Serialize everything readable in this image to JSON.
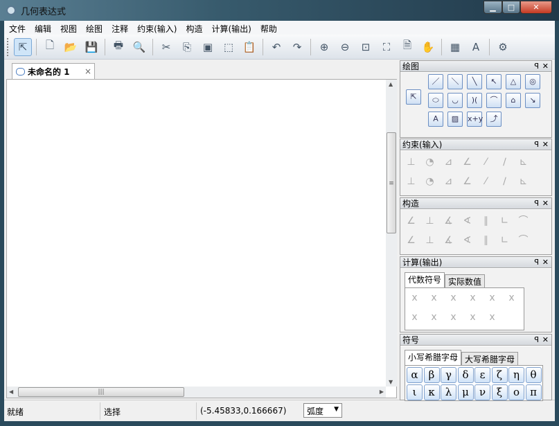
{
  "window": {
    "title": "几何表达式",
    "minimize": "▁",
    "maximize": "□",
    "close": "✕"
  },
  "menu": [
    "文件",
    "编辑",
    "视图",
    "绘图",
    "注释",
    "约束(输入)",
    "构造",
    "计算(输出)",
    "帮助"
  ],
  "toolbar": [
    {
      "icon": "select-arrow-icon",
      "glyph": "⇱",
      "selected": true
    },
    {
      "sep": true
    },
    {
      "icon": "new-file-icon",
      "glyph": "🗋"
    },
    {
      "icon": "open-folder-icon",
      "glyph": "📂"
    },
    {
      "icon": "save-icon",
      "glyph": "💾"
    },
    {
      "sep": true
    },
    {
      "icon": "print-icon",
      "glyph": "🖶"
    },
    {
      "icon": "print-preview-icon",
      "glyph": "🔍"
    },
    {
      "sep": true
    },
    {
      "icon": "cut-icon",
      "glyph": "✂"
    },
    {
      "icon": "copy-icon",
      "glyph": "⎘"
    },
    {
      "icon": "copy-window-icon",
      "glyph": "▣"
    },
    {
      "icon": "copy-selection-icon",
      "glyph": "⬚"
    },
    {
      "icon": "paste-icon",
      "glyph": "📋"
    },
    {
      "sep": true
    },
    {
      "icon": "undo-icon",
      "glyph": "↶"
    },
    {
      "icon": "redo-icon",
      "glyph": "↷"
    },
    {
      "sep": true
    },
    {
      "icon": "zoom-in-icon",
      "glyph": "⊕"
    },
    {
      "icon": "zoom-out-icon",
      "glyph": "⊖"
    },
    {
      "icon": "zoom-rect-icon",
      "glyph": "⊡"
    },
    {
      "icon": "zoom-fit-icon",
      "glyph": "⛶"
    },
    {
      "icon": "zoom-page-icon",
      "glyph": "🗎"
    },
    {
      "icon": "pan-hand-icon",
      "glyph": "✋"
    },
    {
      "sep": true
    },
    {
      "icon": "grid-icon",
      "glyph": "▦"
    },
    {
      "icon": "font-icon",
      "glyph": "A"
    },
    {
      "sep": true
    },
    {
      "icon": "settings-gears-icon",
      "glyph": "⚙"
    }
  ],
  "document_tab": {
    "label": "未命名的 1",
    "close": "×"
  },
  "status": {
    "ready": "就绪",
    "mode": "选择",
    "coords": "(-5.45833,0.166667)",
    "angle_unit": "弧度"
  },
  "panels": {
    "draw": {
      "title": "绘图",
      "icons": [
        "⇱",
        "／",
        "＼",
        "╲",
        "↖",
        "△",
        "◎",
        "⬭",
        "◡",
        ")(",
        "⌒",
        "⌂",
        "↘",
        "A",
        "▨",
        "x+y",
        "⤴"
      ]
    },
    "constraint": {
      "title": "约束(输入)"
    },
    "construct": {
      "title": "构造"
    },
    "compute": {
      "title": "计算(输出)",
      "tabs": [
        "代数符号",
        "实际数值"
      ]
    },
    "symbols": {
      "title": "符号",
      "tabs": [
        "小写希腊字母",
        "大写希腊字母"
      ],
      "letters": [
        "α",
        "β",
        "γ",
        "δ",
        "ε",
        "ζ",
        "η",
        "θ",
        "ι",
        "κ",
        "λ",
        "μ",
        "ν",
        "ξ",
        "ο",
        "π"
      ]
    }
  },
  "pin": "ꟼ",
  "close": "✕"
}
